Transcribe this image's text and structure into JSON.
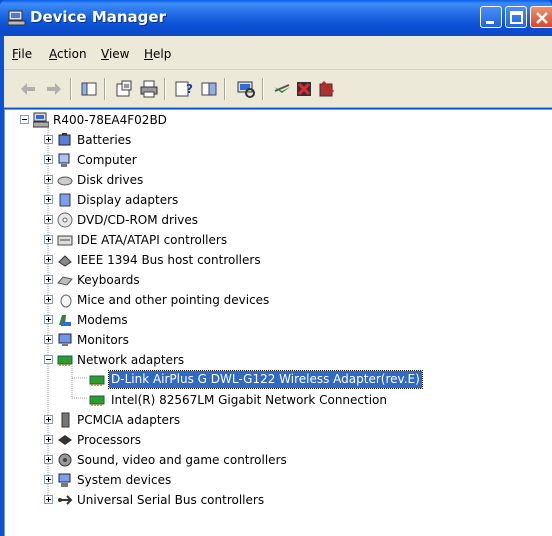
{
  "window": {
    "title": "Device Manager"
  },
  "menu": {
    "items": [
      {
        "first": "F",
        "rest": "ile"
      },
      {
        "first": "A",
        "rest": "ction"
      },
      {
        "first": "V",
        "rest": "iew"
      },
      {
        "first": "H",
        "rest": "elp"
      }
    ]
  },
  "toolbar": {
    "buttons": [
      "back-icon",
      "forward-icon",
      "console-tree-icon",
      "properties-icon",
      "print-icon",
      "help-icon",
      "show-hide-icon",
      "scan-hardware-icon",
      "update-driver-icon",
      "uninstall-icon",
      "disable-icon"
    ]
  },
  "tree": {
    "root": "R400-78EA4F02BD",
    "categories": [
      {
        "label": "Batteries",
        "icon": "battery-icon"
      },
      {
        "label": "Computer",
        "icon": "computer-icon"
      },
      {
        "label": "Disk drives",
        "icon": "disk-drive-icon"
      },
      {
        "label": "Display adapters",
        "icon": "display-adapter-icon"
      },
      {
        "label": "DVD/CD-ROM drives",
        "icon": "dvd-drive-icon"
      },
      {
        "label": "IDE ATA/ATAPI controllers",
        "icon": "ide-controller-icon"
      },
      {
        "label": "IEEE 1394 Bus host controllers",
        "icon": "ieee1394-icon"
      },
      {
        "label": "Keyboards",
        "icon": "keyboard-icon"
      },
      {
        "label": "Mice and other pointing devices",
        "icon": "mouse-icon"
      },
      {
        "label": "Modems",
        "icon": "modem-icon"
      },
      {
        "label": "Monitors",
        "icon": "monitor-icon"
      },
      {
        "label": "Network adapters",
        "icon": "network-adapter-icon",
        "expanded": true
      },
      {
        "label": "PCMCIA adapters",
        "icon": "pcmcia-icon"
      },
      {
        "label": "Processors",
        "icon": "processor-icon"
      },
      {
        "label": "Sound, video and game controllers",
        "icon": "sound-icon"
      },
      {
        "label": "System devices",
        "icon": "system-device-icon"
      },
      {
        "label": "Universal Serial Bus controllers",
        "icon": "usb-icon"
      }
    ],
    "network_children": [
      {
        "label": "D-Link AirPlus G DWL-G122 Wireless Adapter(rev.E)",
        "selected": true
      },
      {
        "label": "Intel(R) 82567LM Gigabit Network Connection",
        "selected": false
      }
    ]
  },
  "colors": {
    "titlebar": "#0a50d8",
    "selection": "#316ac5",
    "chrome": "#ece9d8"
  }
}
